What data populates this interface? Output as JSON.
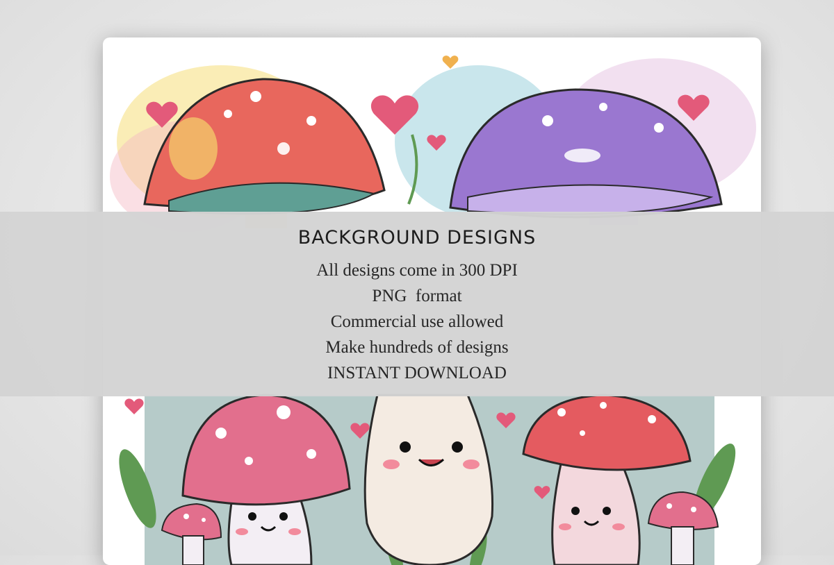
{
  "banner": {
    "title": "BACKGROUND DESIGNS",
    "lines": [
      "All designs come in 300 DPI",
      "PNG  format",
      "Commercial use allowed",
      "Make hundreds of designs",
      "INSTANT DOWNLOAD"
    ]
  },
  "illustration": {
    "subject": "watercolor mushrooms with hearts",
    "colors": {
      "red_cap": "#e8675d",
      "purple_cap": "#9a77d0",
      "pink_cap": "#e26f8d",
      "teal_wash": "#8ecbd6",
      "yellow_wash": "#f3d76a",
      "leaf_green": "#5f9a53",
      "heart": "#e35a7a"
    }
  }
}
